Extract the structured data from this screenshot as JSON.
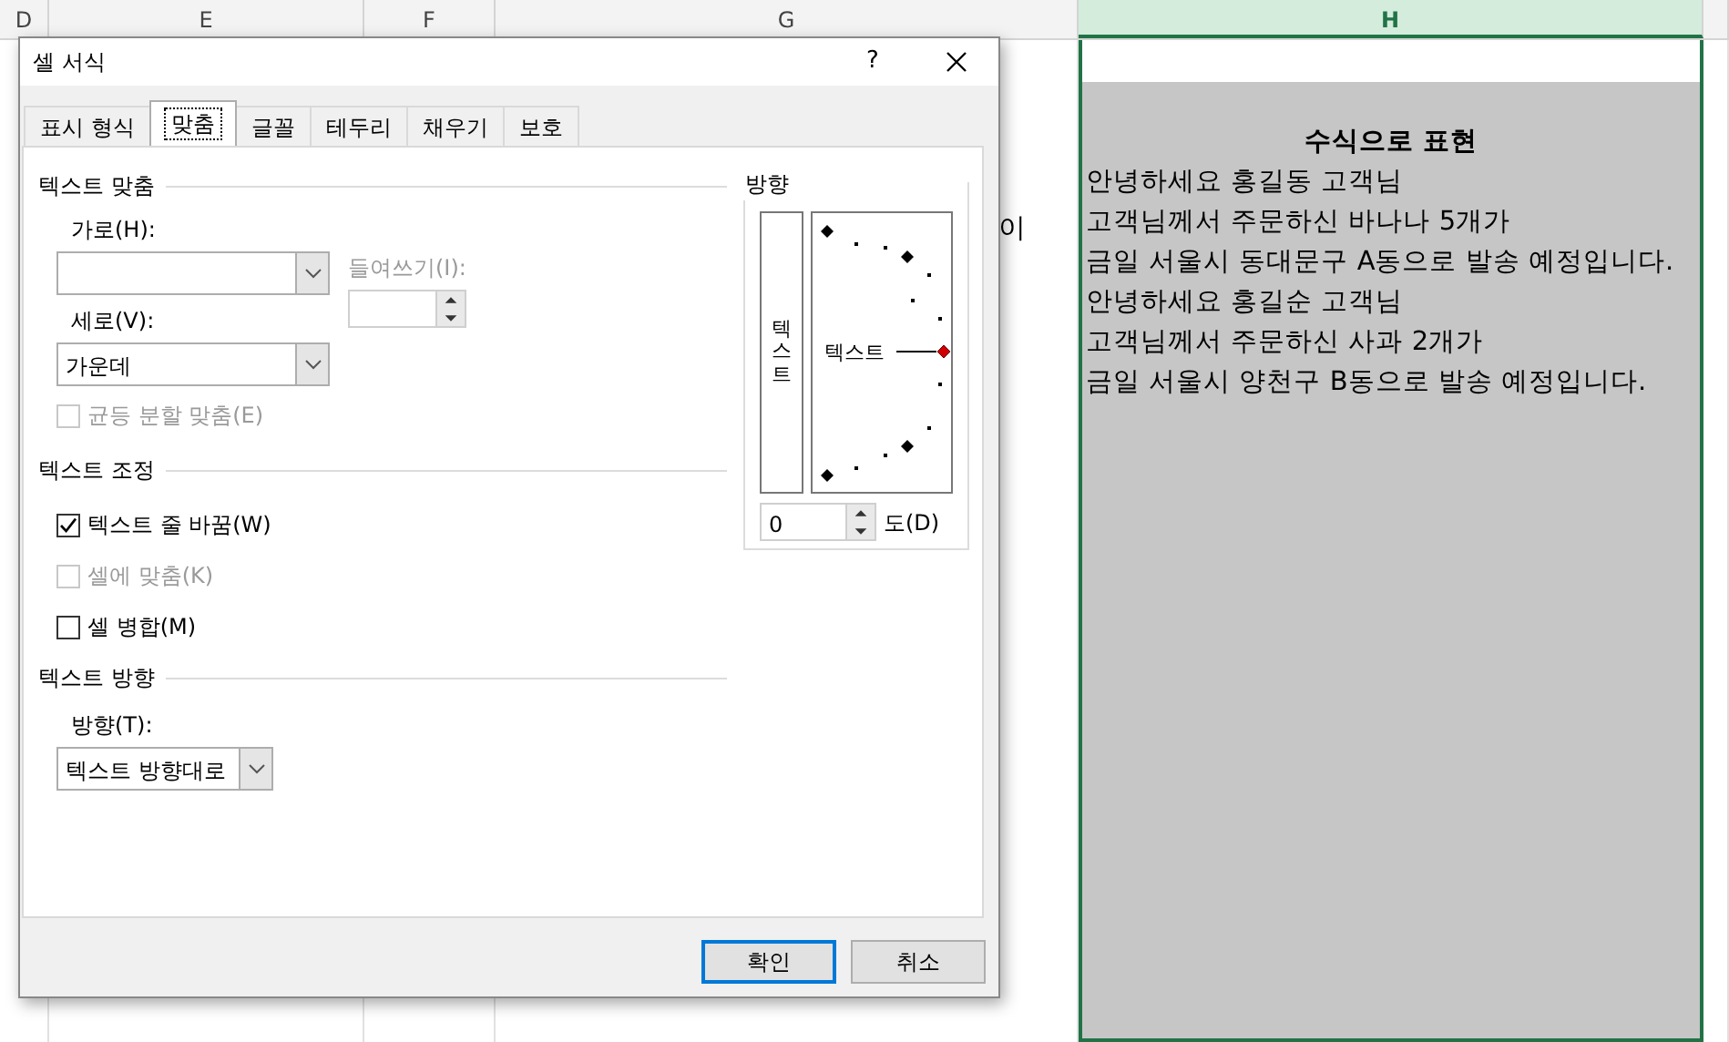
{
  "sheet": {
    "column_headers": [
      {
        "label": "D",
        "selected": false
      },
      {
        "label": "E",
        "selected": false
      },
      {
        "label": "F",
        "selected": false
      },
      {
        "label": "G",
        "selected": false
      },
      {
        "label": "H",
        "selected": true
      }
    ],
    "cell_fragment": "이",
    "cell": {
      "lines": [
        {
          "kind": "title",
          "text": "수식으로 표현"
        },
        {
          "kind": "line",
          "text": "안녕하세요 홍길동 고객님"
        },
        {
          "kind": "line",
          "text": "고객님께서 주문하신 바나나 5개가"
        },
        {
          "kind": "line",
          "text": "금일 서울시 동대문구 A동으로 발송 예정입니다."
        },
        {
          "kind": "line",
          "text": "안녕하세요 홍길순 고객님"
        },
        {
          "kind": "line",
          "text": "고객님께서 주문하신 사과 2개가"
        },
        {
          "kind": "line",
          "text": "금일 서울시 양천구 B동으로 발송 예정입니다."
        }
      ]
    }
  },
  "dialog": {
    "title": "셀 서식",
    "help": "?",
    "tabs": [
      {
        "label": "표시 형식",
        "selected": false
      },
      {
        "label": "맞춤",
        "selected": true
      },
      {
        "label": "글꼴",
        "selected": false
      },
      {
        "label": "테두리",
        "selected": false
      },
      {
        "label": "채우기",
        "selected": false
      },
      {
        "label": "보호",
        "selected": false
      }
    ],
    "text_alignment": {
      "heading": "텍스트 맞춤",
      "horizontal": {
        "label": "가로(H):"
      },
      "indent": {
        "label": "들여쓰기(I):",
        "disabled": true
      },
      "vertical": {
        "label": "세로(V):",
        "value": "가운데"
      },
      "justify_distributed": {
        "label": "균등 분할 맞춤(E)",
        "checked": false,
        "disabled": true
      }
    },
    "text_control": {
      "heading": "텍스트 조정",
      "options": [
        {
          "label": "텍스트 줄 바꿈(W)",
          "checked": true,
          "disabled": false
        },
        {
          "label": "셀에 맞춤(K)",
          "checked": false,
          "disabled": true
        },
        {
          "label": "셀 병합(M)",
          "checked": false,
          "disabled": false
        }
      ]
    },
    "text_direction": {
      "heading": "텍스트 방향",
      "label": "방향(T):",
      "value": "텍스트 방향대로"
    },
    "orientation": {
      "heading": "방향",
      "vertical_text": "텍스트",
      "dial_text": "텍스트",
      "degrees": "0",
      "degrees_label": "도(D)"
    },
    "buttons": [
      {
        "label": "확인",
        "default": true
      },
      {
        "label": "취소",
        "default": false
      }
    ]
  }
}
